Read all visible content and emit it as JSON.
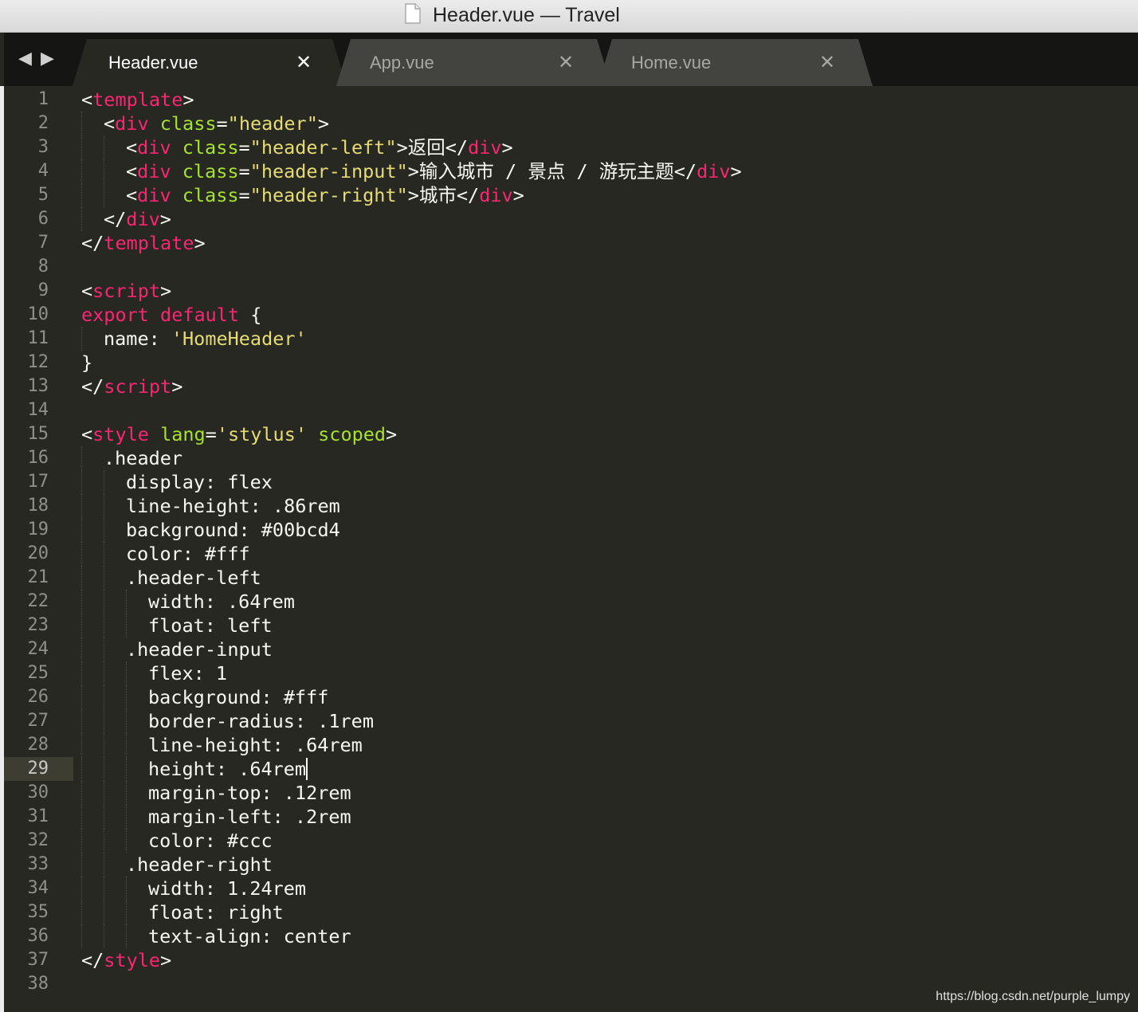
{
  "window": {
    "title": "Header.vue — Travel",
    "file_icon": "document-icon"
  },
  "nav": {
    "back": "◀",
    "forward": "▶"
  },
  "tabs": [
    {
      "label": "Header.vue",
      "active": true,
      "close": "✕"
    },
    {
      "label": "App.vue",
      "active": false,
      "close": "✕"
    },
    {
      "label": "Home.vue",
      "active": false,
      "close": "✕"
    }
  ],
  "editor": {
    "current_line": 29,
    "colors": {
      "background": "#272822",
      "tag": "#f92672",
      "attribute": "#a6e22e",
      "string": "#e6db74",
      "text": "#f8f8f2",
      "gutter": "#8f908a"
    },
    "lines": [
      {
        "n": "1",
        "indent": 0,
        "tokens": [
          [
            "p",
            "<"
          ],
          [
            "tag",
            "template"
          ],
          [
            "p",
            ">"
          ]
        ]
      },
      {
        "n": "2",
        "indent": 1,
        "tokens": [
          [
            "p",
            "<"
          ],
          [
            "tag",
            "div"
          ],
          [
            "p",
            " "
          ],
          [
            "attr",
            "class"
          ],
          [
            "p",
            "="
          ],
          [
            "str",
            "\"header\""
          ],
          [
            "p",
            ">"
          ]
        ]
      },
      {
        "n": "3",
        "indent": 2,
        "tokens": [
          [
            "p",
            "<"
          ],
          [
            "tag",
            "div"
          ],
          [
            "p",
            " "
          ],
          [
            "attr",
            "class"
          ],
          [
            "p",
            "="
          ],
          [
            "str",
            "\"header-left\""
          ],
          [
            "p",
            ">返回</"
          ],
          [
            "tag",
            "div"
          ],
          [
            "p",
            ">"
          ]
        ]
      },
      {
        "n": "4",
        "indent": 2,
        "tokens": [
          [
            "p",
            "<"
          ],
          [
            "tag",
            "div"
          ],
          [
            "p",
            " "
          ],
          [
            "attr",
            "class"
          ],
          [
            "p",
            "="
          ],
          [
            "str",
            "\"header-input\""
          ],
          [
            "p",
            ">输入城市 / 景点 / 游玩主题</"
          ],
          [
            "tag",
            "div"
          ],
          [
            "p",
            ">"
          ]
        ]
      },
      {
        "n": "5",
        "indent": 2,
        "tokens": [
          [
            "p",
            "<"
          ],
          [
            "tag",
            "div"
          ],
          [
            "p",
            " "
          ],
          [
            "attr",
            "class"
          ],
          [
            "p",
            "="
          ],
          [
            "str",
            "\"header-right\""
          ],
          [
            "p",
            ">城市</"
          ],
          [
            "tag",
            "div"
          ],
          [
            "p",
            ">"
          ]
        ]
      },
      {
        "n": "6",
        "indent": 1,
        "tokens": [
          [
            "p",
            "</"
          ],
          [
            "tag",
            "div"
          ],
          [
            "p",
            ">"
          ]
        ]
      },
      {
        "n": "7",
        "indent": 0,
        "tokens": [
          [
            "p",
            "</"
          ],
          [
            "tag",
            "template"
          ],
          [
            "p",
            ">"
          ]
        ]
      },
      {
        "n": "8",
        "indent": 0,
        "tokens": []
      },
      {
        "n": "9",
        "indent": 0,
        "tokens": [
          [
            "p",
            "<"
          ],
          [
            "tag",
            "script"
          ],
          [
            "p",
            ">"
          ]
        ]
      },
      {
        "n": "10",
        "indent": 0,
        "tokens": [
          [
            "kw",
            "export"
          ],
          [
            "p",
            " "
          ],
          [
            "kw",
            "default"
          ],
          [
            "p",
            " {"
          ]
        ]
      },
      {
        "n": "11",
        "indent": 1,
        "tokens": [
          [
            "p",
            "name: "
          ],
          [
            "str",
            "'HomeHeader'"
          ]
        ]
      },
      {
        "n": "12",
        "indent": 0,
        "tokens": [
          [
            "p",
            "}"
          ]
        ]
      },
      {
        "n": "13",
        "indent": 0,
        "tokens": [
          [
            "p",
            "</"
          ],
          [
            "tag",
            "script"
          ],
          [
            "p",
            ">"
          ]
        ]
      },
      {
        "n": "14",
        "indent": 0,
        "tokens": []
      },
      {
        "n": "15",
        "indent": 0,
        "tokens": [
          [
            "p",
            "<"
          ],
          [
            "tag",
            "style"
          ],
          [
            "p",
            " "
          ],
          [
            "attr",
            "lang"
          ],
          [
            "p",
            "="
          ],
          [
            "str",
            "'stylus'"
          ],
          [
            "p",
            " "
          ],
          [
            "attr",
            "scoped"
          ],
          [
            "p",
            ">"
          ]
        ]
      },
      {
        "n": "16",
        "indent": 1,
        "tokens": [
          [
            "p",
            ".header"
          ]
        ]
      },
      {
        "n": "17",
        "indent": 2,
        "tokens": [
          [
            "p",
            "display: flex"
          ]
        ]
      },
      {
        "n": "18",
        "indent": 2,
        "tokens": [
          [
            "p",
            "line-height: .86rem"
          ]
        ]
      },
      {
        "n": "19",
        "indent": 2,
        "tokens": [
          [
            "p",
            "background: #00bcd4"
          ]
        ]
      },
      {
        "n": "20",
        "indent": 2,
        "tokens": [
          [
            "p",
            "color: #fff"
          ]
        ]
      },
      {
        "n": "21",
        "indent": 2,
        "tokens": [
          [
            "p",
            ".header-left"
          ]
        ]
      },
      {
        "n": "22",
        "indent": 3,
        "tokens": [
          [
            "p",
            "width: .64rem"
          ]
        ]
      },
      {
        "n": "23",
        "indent": 3,
        "tokens": [
          [
            "p",
            "float: left"
          ]
        ]
      },
      {
        "n": "24",
        "indent": 2,
        "tokens": [
          [
            "p",
            ".header-input"
          ]
        ]
      },
      {
        "n": "25",
        "indent": 3,
        "tokens": [
          [
            "p",
            "flex: 1"
          ]
        ]
      },
      {
        "n": "26",
        "indent": 3,
        "tokens": [
          [
            "p",
            "background: #fff"
          ]
        ]
      },
      {
        "n": "27",
        "indent": 3,
        "tokens": [
          [
            "p",
            "border-radius: .1rem"
          ]
        ]
      },
      {
        "n": "28",
        "indent": 3,
        "tokens": [
          [
            "p",
            "line-height: .64rem"
          ]
        ]
      },
      {
        "n": "29",
        "indent": 3,
        "tokens": [
          [
            "p",
            "height: .64rem"
          ]
        ]
      },
      {
        "n": "30",
        "indent": 3,
        "tokens": [
          [
            "p",
            "margin-top: .12rem"
          ]
        ]
      },
      {
        "n": "31",
        "indent": 3,
        "tokens": [
          [
            "p",
            "margin-left: .2rem"
          ]
        ]
      },
      {
        "n": "32",
        "indent": 3,
        "tokens": [
          [
            "p",
            "color: #ccc"
          ]
        ]
      },
      {
        "n": "33",
        "indent": 2,
        "tokens": [
          [
            "p",
            ".header-right"
          ]
        ]
      },
      {
        "n": "34",
        "indent": 3,
        "tokens": [
          [
            "p",
            "width: 1.24rem"
          ]
        ]
      },
      {
        "n": "35",
        "indent": 3,
        "tokens": [
          [
            "p",
            "float: right"
          ]
        ]
      },
      {
        "n": "36",
        "indent": 3,
        "tokens": [
          [
            "p",
            "text-align: center"
          ]
        ]
      },
      {
        "n": "37",
        "indent": 0,
        "tokens": [
          [
            "p",
            "</"
          ],
          [
            "tag",
            "style"
          ],
          [
            "p",
            ">"
          ]
        ]
      },
      {
        "n": "38",
        "indent": 0,
        "tokens": []
      }
    ]
  },
  "watermark": "https://blog.csdn.net/purple_lumpy"
}
